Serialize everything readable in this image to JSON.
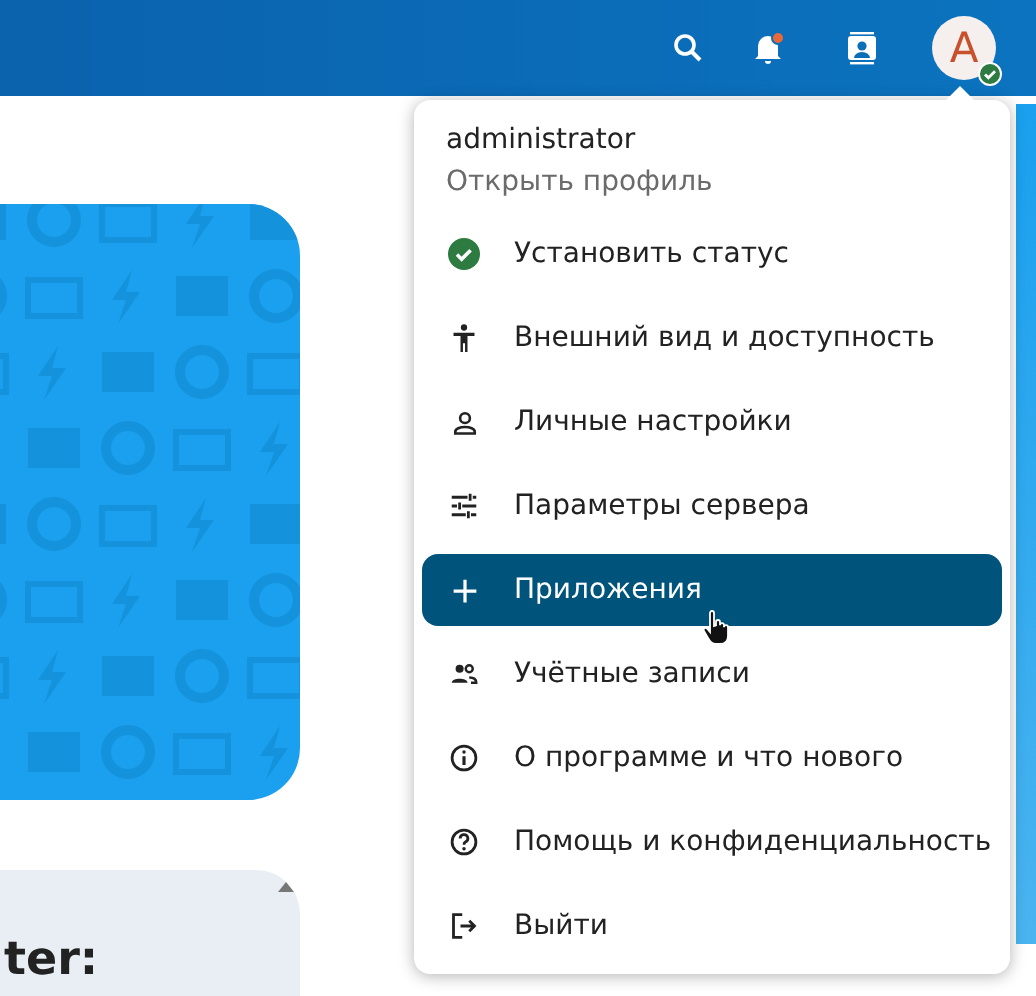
{
  "header": {
    "notifications": {
      "unread": true
    },
    "avatar": {
      "initial": "A",
      "online": true
    }
  },
  "card": {
    "heading": "ter:"
  },
  "menu": {
    "user": "administrator",
    "profile_link": "Открыть профиль",
    "items": [
      {
        "kind": "status",
        "label": "Установить статус",
        "selected": false
      },
      {
        "kind": "accessibility",
        "label": "Внешний вид и доступность",
        "selected": false
      },
      {
        "kind": "person",
        "label": "Личные настройки",
        "selected": false
      },
      {
        "kind": "sliders",
        "label": "Параметры сервера",
        "selected": false
      },
      {
        "kind": "plus",
        "label": "Приложения",
        "selected": true
      },
      {
        "kind": "people",
        "label": "Учётные записи",
        "selected": false
      },
      {
        "kind": "info",
        "label": "О программе и что нового",
        "selected": false
      },
      {
        "kind": "help",
        "label": "Помощь и конфиденциальность",
        "selected": false
      },
      {
        "kind": "logout",
        "label": "Выйти",
        "selected": false
      }
    ]
  }
}
